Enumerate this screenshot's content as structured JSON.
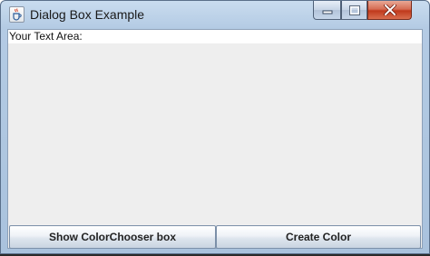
{
  "window": {
    "title": "Dialog Box Example",
    "app_icon": "java-cup-icon",
    "controls": [
      "minimize-icon",
      "maximize-icon",
      "close-icon"
    ]
  },
  "main": {
    "text_area_label": "Your Text Area:",
    "buttons": {
      "show_color_chooser": "Show ColorChooser box",
      "create_color": "Create Color"
    }
  },
  "colors": {
    "content_background": "#eeeeee",
    "close_button": "#c9452a"
  }
}
